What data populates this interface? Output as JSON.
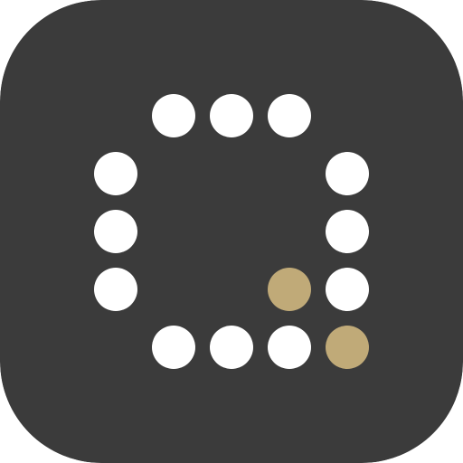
{
  "icon": {
    "icon_name": "dot-matrix-q-logo-icon",
    "colors": {
      "background": "#3b3b3b",
      "dot_primary": "#ffffff",
      "dot_accent": "#c0aa78"
    },
    "dot_grid": {
      "columns": 5,
      "rows": 5,
      "cells": [
        {
          "col": 1,
          "row": 0,
          "tone": "primary"
        },
        {
          "col": 2,
          "row": 0,
          "tone": "primary"
        },
        {
          "col": 3,
          "row": 0,
          "tone": "primary"
        },
        {
          "col": 0,
          "row": 1,
          "tone": "primary"
        },
        {
          "col": 4,
          "row": 1,
          "tone": "primary"
        },
        {
          "col": 0,
          "row": 2,
          "tone": "primary"
        },
        {
          "col": 4,
          "row": 2,
          "tone": "primary"
        },
        {
          "col": 0,
          "row": 3,
          "tone": "primary"
        },
        {
          "col": 3,
          "row": 3,
          "tone": "accent"
        },
        {
          "col": 4,
          "row": 3,
          "tone": "primary"
        },
        {
          "col": 1,
          "row": 4,
          "tone": "primary"
        },
        {
          "col": 2,
          "row": 4,
          "tone": "primary"
        },
        {
          "col": 3,
          "row": 4,
          "tone": "primary"
        },
        {
          "col": 4,
          "row": 4,
          "tone": "accent"
        }
      ]
    }
  }
}
